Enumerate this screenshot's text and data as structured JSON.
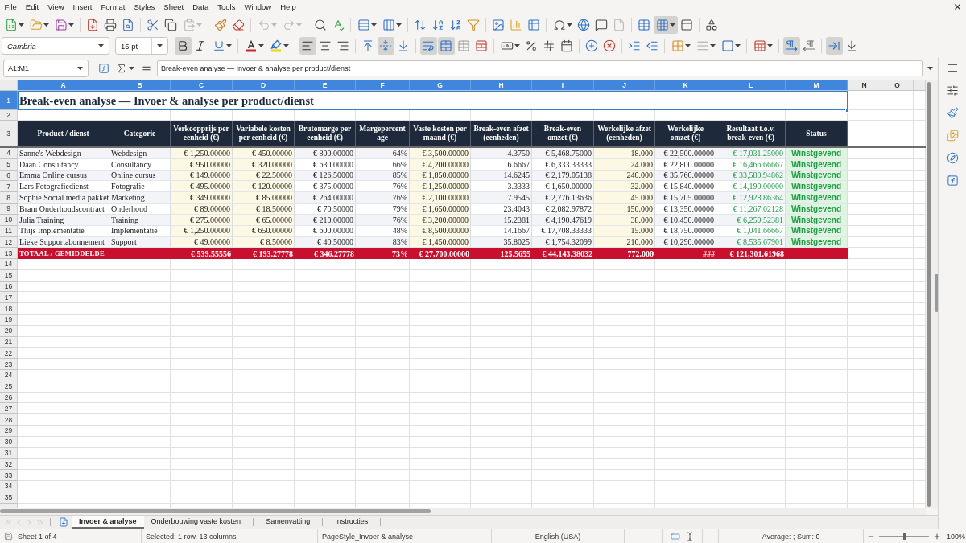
{
  "menu_bar": [
    "File",
    "Edit",
    "View",
    "Insert",
    "Format",
    "Styles",
    "Sheet",
    "Data",
    "Tools",
    "Window",
    "Help"
  ],
  "standard_toolbar": {
    "paste_disabled": true,
    "undo_disabled": true,
    "redo_disabled": true,
    "header_footer_disabled": true,
    "freeze_rows_columns": true
  },
  "formatting_toolbar": {
    "font_name": "Cambria",
    "font_size": "15 pt",
    "bold": true,
    "italic": false,
    "underline": false,
    "align_left": true,
    "align_center": false,
    "align_right": false,
    "align_top": false,
    "align_middle": true,
    "align_bottom": false,
    "wrap_text": true,
    "merge_and_center": true,
    "merge_cells": false,
    "unmerge_cells": false,
    "left_to_right": true,
    "right_to_left": false,
    "text_left_to_right": true,
    "text_top_to_bottom": false
  },
  "formula_bar": {
    "cell_reference": "A1:M1",
    "formula": "Break-even analyse — Invoer & analyse per product/dienst"
  },
  "sheet": {
    "column_headers": [
      {
        "label": "A",
        "selected": true
      },
      {
        "label": "B",
        "selected": true
      },
      {
        "label": "C",
        "selected": true
      },
      {
        "label": "D",
        "selected": true
      },
      {
        "label": "E",
        "selected": true
      },
      {
        "label": "F",
        "selected": true
      },
      {
        "label": "G",
        "selected": true
      },
      {
        "label": "H",
        "selected": true
      },
      {
        "label": "I",
        "selected": true
      },
      {
        "label": "J",
        "selected": true
      },
      {
        "label": "K",
        "selected": true
      },
      {
        "label": "L",
        "selected": true
      },
      {
        "label": "M",
        "selected": true
      },
      {
        "label": "N",
        "selected": false
      },
      {
        "label": "O",
        "selected": false
      }
    ],
    "row_headers": [
      {
        "label": "1",
        "selected": true
      },
      {
        "label": "2",
        "selected": false
      },
      {
        "label": "3",
        "selected": false
      },
      {
        "label": "4",
        "selected": false
      },
      {
        "label": "5",
        "selected": false
      },
      {
        "label": "6",
        "selected": false
      },
      {
        "label": "7",
        "selected": false
      },
      {
        "label": "8",
        "selected": false
      },
      {
        "label": "9",
        "selected": false
      },
      {
        "label": "10",
        "selected": false
      },
      {
        "label": "11",
        "selected": false
      },
      {
        "label": "12",
        "selected": false
      },
      {
        "label": "13",
        "selected": false
      },
      {
        "label": "14",
        "selected": false
      },
      {
        "label": "15",
        "selected": false
      },
      {
        "label": "16",
        "selected": false
      },
      {
        "label": "17",
        "selected": false
      },
      {
        "label": "18",
        "selected": false
      },
      {
        "label": "19",
        "selected": false
      },
      {
        "label": "20",
        "selected": false
      },
      {
        "label": "21",
        "selected": false
      },
      {
        "label": "22",
        "selected": false
      },
      {
        "label": "23",
        "selected": false
      },
      {
        "label": "24",
        "selected": false
      },
      {
        "label": "25",
        "selected": false
      },
      {
        "label": "26",
        "selected": false
      },
      {
        "label": "27",
        "selected": false
      },
      {
        "label": "28",
        "selected": false
      },
      {
        "label": "29",
        "selected": false
      },
      {
        "label": "30",
        "selected": false
      },
      {
        "label": "31",
        "selected": false
      },
      {
        "label": "32",
        "selected": false
      },
      {
        "label": "33",
        "selected": false
      },
      {
        "label": "34",
        "selected": false
      },
      {
        "label": "35",
        "selected": false
      }
    ],
    "title": "Break-even analyse — Invoer & analyse per product/dienst",
    "columns": [
      {
        "heading": "Product / dienst",
        "kind": "text"
      },
      {
        "heading": "Categorie",
        "kind": "text"
      },
      {
        "heading": "Verkoopprijs per eenheid (€)",
        "kind": "input"
      },
      {
        "heading": "Variabele kosten per eenheid (€)",
        "kind": "input"
      },
      {
        "heading": "Brutomarge per eenheid (€)",
        "kind": "calc"
      },
      {
        "heading": "Margepercentage",
        "kind": "calc"
      },
      {
        "heading": "Vaste kosten per maand (€)",
        "kind": "input"
      },
      {
        "heading": "Break-even afzet (eenheden)",
        "kind": "calc"
      },
      {
        "heading": "Break-even omzet (€)",
        "kind": "calc"
      },
      {
        "heading": "Werkelijke afzet (eenheden)",
        "kind": "input"
      },
      {
        "heading": "Werkelijke omzet (€)",
        "kind": "calc"
      },
      {
        "heading": "Resultaat t.o.v. break-even (€)",
        "kind": "result"
      },
      {
        "heading": "Status",
        "kind": "status"
      }
    ],
    "rows": [
      [
        "Sanne's Webdesign",
        "Webdesign",
        "€ 1,250.00000",
        "€ 450.00000",
        "€ 800.00000",
        "64%",
        "€ 3,500.00000",
        "4.3750",
        "€ 5,468.75000",
        "18.000",
        "€ 22,500.00000",
        "€ 17,031.25000",
        "Winstgevend"
      ],
      [
        "Daan Consultancy",
        "Consultancy",
        "€ 950.00000",
        "€ 320.00000",
        "€ 630.00000",
        "66%",
        "€ 4,200.00000",
        "6.6667",
        "€ 6,333.33333",
        "24.000",
        "€ 22,800.00000",
        "€ 16,466.66667",
        "Winstgevend"
      ],
      [
        "Emma Online cursus",
        "Online cursus",
        "€ 149.00000",
        "€ 22.50000",
        "€ 126.50000",
        "85%",
        "€ 1,850.00000",
        "14.6245",
        "€ 2,179.05138",
        "240.000",
        "€ 35,760.00000",
        "€ 33,580.94862",
        "Winstgevend"
      ],
      [
        "Lars Fotografiedienst",
        "Fotografie",
        "€ 495.00000",
        "€ 120.00000",
        "€ 375.00000",
        "76%",
        "€ 1,250.00000",
        "3.3333",
        "€ 1,650.00000",
        "32.000",
        "€ 15,840.00000",
        "€ 14,190.00000",
        "Winstgevend"
      ],
      [
        "Sophie Social media pakket",
        "Marketing",
        "€ 349.00000",
        "€ 85.00000",
        "€ 264.00000",
        "76%",
        "€ 2,100.00000",
        "7.9545",
        "€ 2,776.13636",
        "45.000",
        "€ 15,705.00000",
        "€ 12,928.86364",
        "Winstgevend"
      ],
      [
        "Bram Onderhoudscontract",
        "Onderhoud",
        "€ 89.00000",
        "€ 18.50000",
        "€ 70.50000",
        "79%",
        "€ 1,650.00000",
        "23.4043",
        "€ 2,082.97872",
        "150.000",
        "€ 13,350.00000",
        "€ 11,267.02128",
        "Winstgevend"
      ],
      [
        "Julia Training",
        "Training",
        "€ 275.00000",
        "€ 65.00000",
        "€ 210.00000",
        "76%",
        "€ 3,200.00000",
        "15.2381",
        "€ 4,190.47619",
        "38.000",
        "€ 10,450.00000",
        "€ 6,259.52381",
        "Winstgevend"
      ],
      [
        "Thijs Implementatie",
        "Implementatie",
        "€ 1,250.00000",
        "€ 650.00000",
        "€ 600.00000",
        "48%",
        "€ 8,500.00000",
        "14.1667",
        "€ 17,708.33333",
        "15.000",
        "€ 18,750.00000",
        "€ 1,041.66667",
        "Winstgevend"
      ],
      [
        "Lieke Supportabonnement",
        "Support",
        "€ 49.00000",
        "€ 8.50000",
        "€ 40.50000",
        "83%",
        "€ 1,450.00000",
        "35.8025",
        "€ 1,754.32099",
        "210.000",
        "€ 10,290.00000",
        "€ 8,535.67901",
        "Winstgevend"
      ]
    ],
    "total_row": {
      "label": "TOTAAL / GEMIDDELDE",
      "cells": [
        {
          "text": "€ 539.55556",
          "clipped": false
        },
        {
          "text": "€ 193.27778",
          "clipped": false
        },
        {
          "text": "€ 346.27778",
          "clipped": false
        },
        {
          "text": "73%",
          "clipped": false
        },
        {
          "text": "€ 27,700.00000",
          "clipped": false
        },
        {
          "text": "125.5655",
          "clipped": false
        },
        {
          "text": "€ 44,143.38032",
          "clipped": false
        },
        {
          "text": "772.000",
          "clipped": true
        },
        {
          "text": "###",
          "clipped": false
        },
        {
          "text": "€ 121,301.61968",
          "clipped": false
        }
      ]
    }
  },
  "sheet_tab_bar": {
    "navigation_disabled": true,
    "tabs": [
      {
        "label": "Invoer & analyse",
        "selected": true
      },
      {
        "label": "Onderbouwing vaste kosten",
        "selected": false
      },
      {
        "label": "Samenvatting",
        "selected": false
      },
      {
        "label": "Instructies",
        "selected": false
      }
    ]
  },
  "status_bar": {
    "sheet_position": "Sheet 1 of 4",
    "selection": "Selected: 1 row, 13 columns",
    "page_style": "PageStyle_Invoer & analyse",
    "language": "English (USA)",
    "summary": "Average: ; Sum: 0",
    "zoom_slider": {
      "level": 0.5
    },
    "zoom": "100%"
  }
}
